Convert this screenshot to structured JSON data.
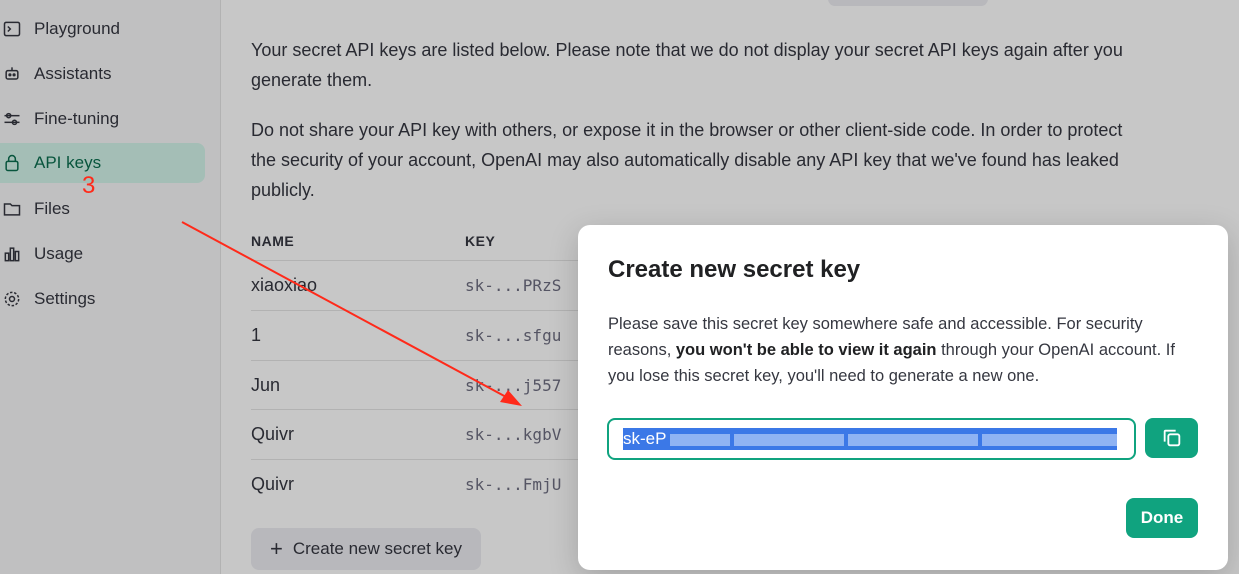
{
  "sidebar": {
    "items": [
      {
        "label": "Playground",
        "icon": "terminal-icon"
      },
      {
        "label": "Assistants",
        "icon": "robot-icon"
      },
      {
        "label": "Fine-tuning",
        "icon": "sliders-icon"
      },
      {
        "label": "API keys",
        "icon": "lock-icon",
        "active": true
      },
      {
        "label": "Files",
        "icon": "folder-icon"
      },
      {
        "label": "Usage",
        "icon": "bar-chart-icon"
      },
      {
        "label": "Settings",
        "icon": "gear-icon"
      }
    ]
  },
  "main": {
    "intro_text": "Your secret API keys are listed below. Please note that we do not display your secret API keys again after you generate them.",
    "warning_text": "Do not share your API key with others, or expose it in the browser or other client-side code. In order to protect the security of your account, OpenAI may also automatically disable any API key that we've found has leaked publicly.",
    "table": {
      "headers": {
        "name": "NAME",
        "key": "KEY"
      },
      "rows": [
        {
          "name": "xiaoxiao",
          "key": "sk-...PRzS"
        },
        {
          "name": "1",
          "key": "sk-...sfgu"
        },
        {
          "name": "Jun",
          "key": "sk-...j557"
        },
        {
          "name": "Quivr",
          "key": "sk-...kgbV"
        },
        {
          "name": "Quivr",
          "key": "sk-...FmjU"
        }
      ]
    },
    "create_button_label": "Create new secret key"
  },
  "annotation": {
    "step_number": "3",
    "color": "#ff2a1a"
  },
  "modal": {
    "title": "Create new secret key",
    "text_before_bold": "Please save this secret key somewhere safe and accessible. For security reasons, ",
    "text_bold": "you won't be able to view it again",
    "text_after_bold": " through your OpenAI account. If you lose this secret key, you'll need to generate a new one.",
    "key_value_visible": "sk-eP",
    "done_label": "Done"
  },
  "colors": {
    "accent": "#10a37f",
    "active_bg": "#d2f4e9",
    "selection": "#3b78e7"
  }
}
